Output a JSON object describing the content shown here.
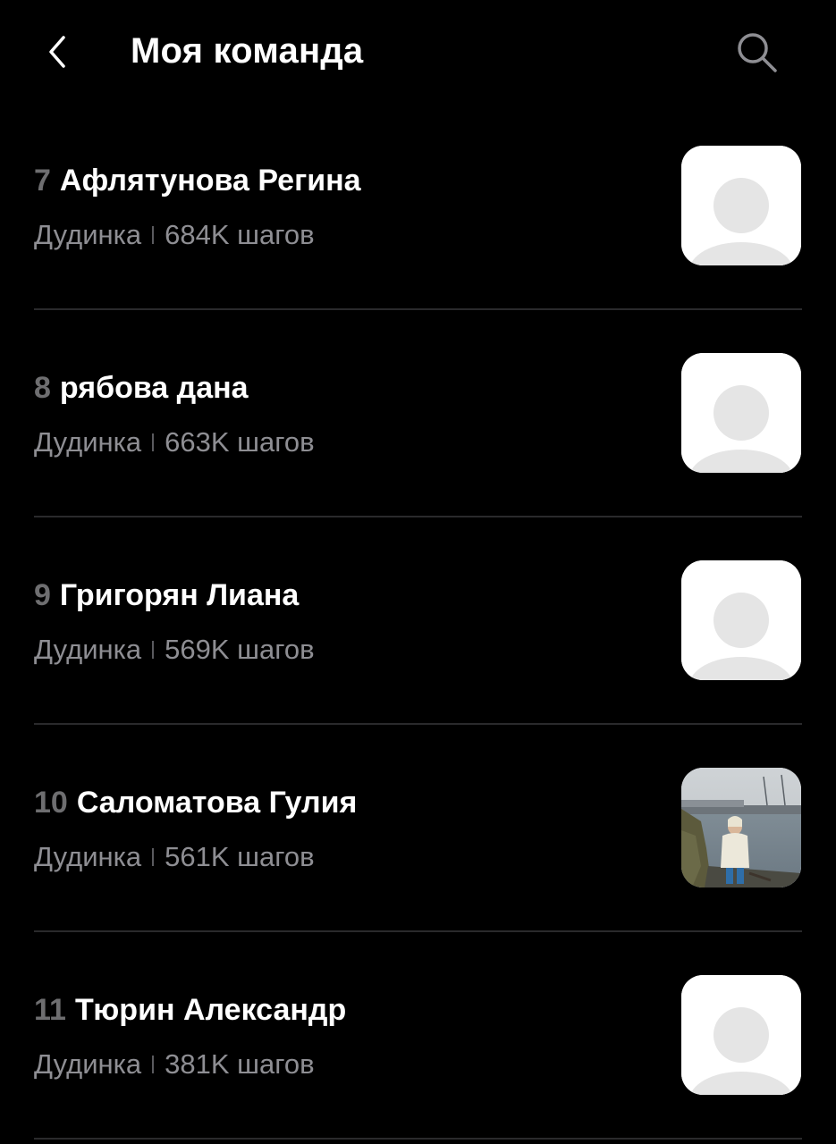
{
  "header": {
    "title": "Моя команда",
    "back_icon": "chevron-left-icon",
    "search_icon": "search-icon"
  },
  "members": [
    {
      "rank": "7",
      "name": "Афлятунова Регина",
      "city": "Дудинка",
      "steps": "684K шагов",
      "avatar": "placeholder"
    },
    {
      "rank": "8",
      "name": "рябова дана",
      "city": "Дудинка",
      "steps": "663K шагов",
      "avatar": "placeholder"
    },
    {
      "rank": "9",
      "name": "Григорян Лиана",
      "city": "Дудинка",
      "steps": "569K шагов",
      "avatar": "placeholder"
    },
    {
      "rank": "10",
      "name": "Саломатова Гулия",
      "city": "Дудинка",
      "steps": "561K шагов",
      "avatar": "photo"
    },
    {
      "rank": "11",
      "name": "Тюрин Александр",
      "city": "Дудинка",
      "steps": "381K шагов",
      "avatar": "placeholder"
    }
  ],
  "colors": {
    "background": "#000000",
    "text": "#ffffff",
    "secondary_text": "#8e8e93",
    "rank_text": "#6e6e70",
    "divider": "#2a2a2c",
    "avatar_placeholder": "#e5e5e5"
  }
}
